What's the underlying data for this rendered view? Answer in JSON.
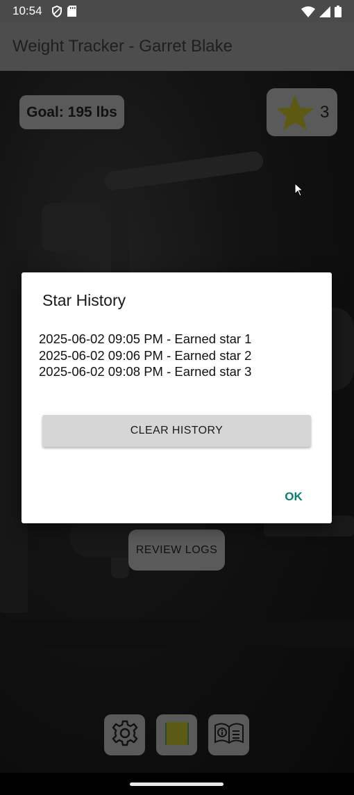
{
  "status_bar": {
    "time": "10:54",
    "icons_left": [
      "shield-icon",
      "sd-card-icon"
    ],
    "icons_right": [
      "wifi-icon",
      "signal-icon",
      "battery-icon"
    ]
  },
  "app_bar": {
    "title": "Weight Tracker - Garret Blake"
  },
  "goal": {
    "label": "Goal: 195 lbs"
  },
  "stars": {
    "icon": "star-icon",
    "count": "3",
    "star_color": "#5c5a12"
  },
  "review_logs": {
    "label": "REVIEW LOGS"
  },
  "bottom_toolbar": {
    "buttons": [
      {
        "icon": "gear-icon"
      },
      {
        "icon": "sticky-note-icon"
      },
      {
        "icon": "info-book-icon"
      }
    ]
  },
  "dialog": {
    "title": "Star History",
    "entries": [
      "2025-06-02 09:05 PM - Earned star 1",
      "2025-06-02 09:06 PM - Earned star 2",
      "2025-06-02 09:08 PM - Earned star 3"
    ],
    "clear_label": "CLEAR HISTORY",
    "ok_label": "OK",
    "accent_color": "#0b7d74"
  }
}
